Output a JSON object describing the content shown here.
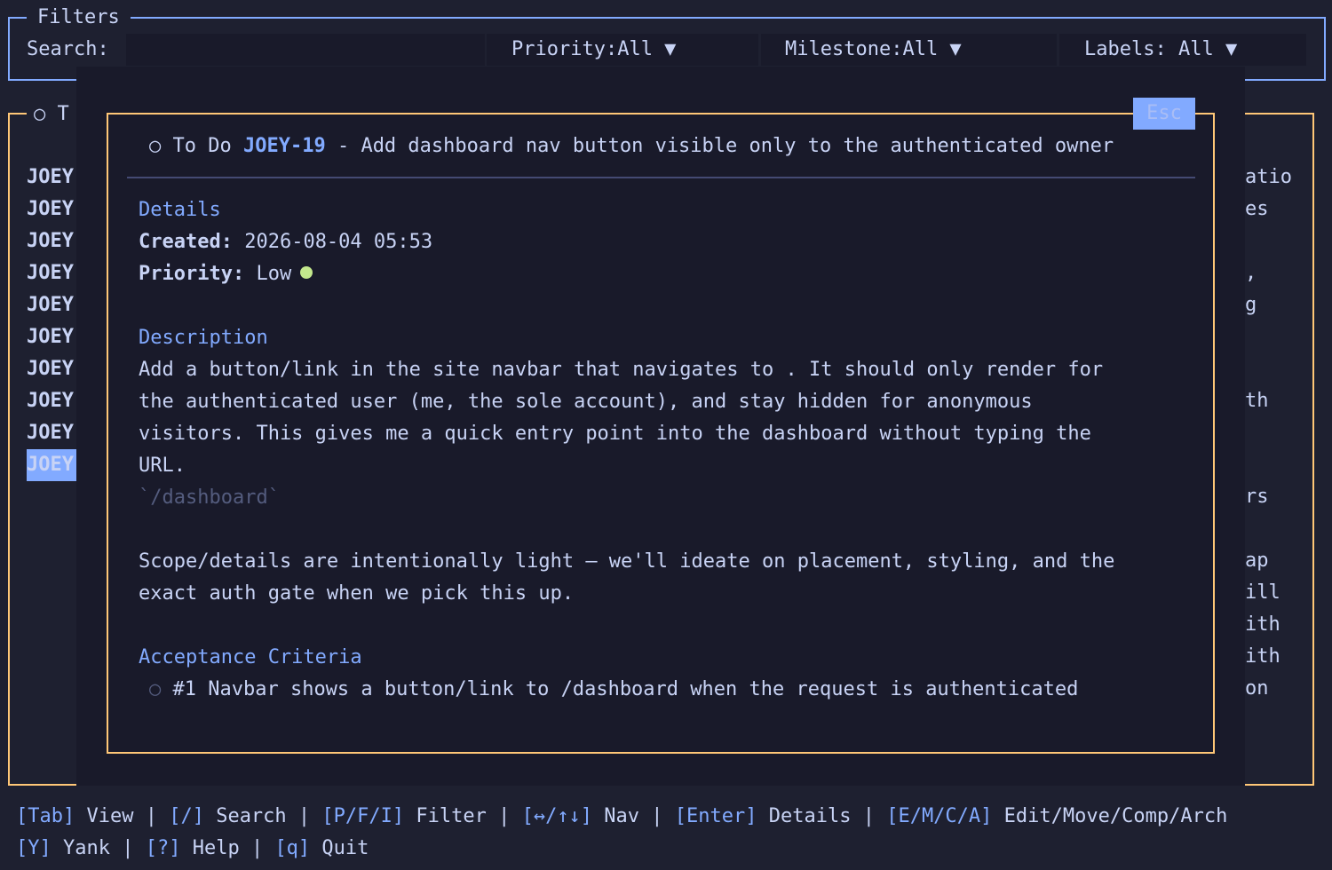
{
  "filters": {
    "title": "Filters",
    "search_label": "Search:",
    "search_value": "",
    "priority": "Priority:All ▼",
    "milestone": "Milestone:All ▼",
    "labels": "Labels: All ▼"
  },
  "list": {
    "title": "○ T",
    "keys": [
      "JOEY",
      "JOEY",
      "JOEY",
      "JOEY",
      "JOEY",
      "JOEY",
      "JOEY",
      "JOEY",
      "JOEY",
      "JOEY"
    ],
    "selected_index": 9,
    "right_fragments": [
      "atio",
      "es",
      "",
      ",",
      "g",
      "",
      "",
      "th",
      "",
      "",
      "rs",
      "",
      "ap",
      "ill",
      "ith",
      "ith",
      "on"
    ]
  },
  "modal": {
    "esc_label": "Esc",
    "status_icon": "○",
    "status": "To Do",
    "issue_key": "JOEY-19",
    "title": "- Add dashboard nav button visible only to the authenticated owner",
    "details_heading": "Details",
    "created_label": "Created:",
    "created_value": "2026-08-04 05:53",
    "priority_label": "Priority:",
    "priority_value": "Low",
    "priority_color": "#c3e88d",
    "description_heading": "Description",
    "description_lines": [
      "Add a button/link in the site navbar that navigates to . It should only render for",
      "the authenticated user (me, the sole account), and stay hidden for anonymous",
      "visitors. This gives me a quick entry point into the dashboard without typing the",
      "URL."
    ],
    "code_snippet": "`/dashboard`",
    "scope_lines": [
      "Scope/details are intentionally light — we'll ideate on placement, styling, and the",
      "exact auth gate when we pick this up."
    ],
    "acceptance_heading": "Acceptance Criteria",
    "criteria": [
      {
        "icon": "○",
        "text": "#1 Navbar shows a button/link to /dashboard when the request is authenticated"
      }
    ]
  },
  "footer": {
    "line1": [
      {
        "key": "[Tab]",
        "label": "View"
      },
      {
        "key": "[/]",
        "label": "Search"
      },
      {
        "key": "[P/F/I]",
        "label": "Filter"
      },
      {
        "key": "[↔/↑↓]",
        "label": "Nav"
      },
      {
        "key": "[Enter]",
        "label": "Details"
      },
      {
        "key": "[E/M/C/A]",
        "label": "Edit/Move/Comp/Arch"
      }
    ],
    "line2": [
      {
        "key": "[Y]",
        "label": "Yank"
      },
      {
        "key": "[?]",
        "label": "Help"
      },
      {
        "key": "[q]",
        "label": "Quit"
      }
    ]
  },
  "colors": {
    "background": "#1e2030",
    "accent": "#82aaff",
    "modal_border": "#ffc777",
    "filter_border": "#82aaff"
  }
}
